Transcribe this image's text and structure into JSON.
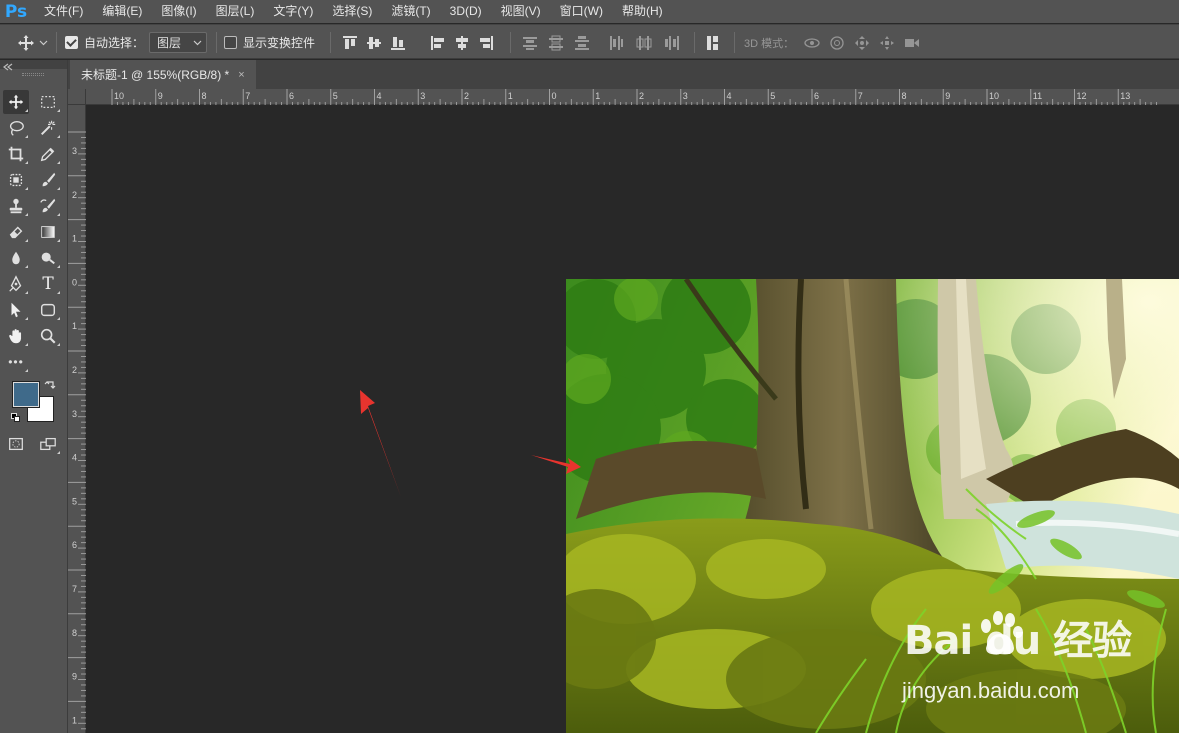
{
  "menubar": {
    "logo": "Ps",
    "items": [
      "文件(F)",
      "编辑(E)",
      "图像(I)",
      "图层(L)",
      "文字(Y)",
      "选择(S)",
      "滤镜(T)",
      "3D(D)",
      "视图(V)",
      "窗口(W)",
      "帮助(H)"
    ]
  },
  "options": {
    "auto_select_label": "自动选择：",
    "auto_select_checked": true,
    "auto_select_target": "图层",
    "show_transform_label": "显示变换控件",
    "show_transform_checked": false,
    "mode_3d_label": "3D 模式："
  },
  "document": {
    "tab_title": "未标题-1 @ 155%(RGB/8) *",
    "close_glyph": "×"
  },
  "rulers": {
    "horizontal_labels": [
      "10",
      "9",
      "8",
      "7",
      "6",
      "5",
      "4",
      "3",
      "2",
      "1",
      "0",
      "1",
      "2",
      "3",
      "4",
      "5",
      "6",
      "7",
      "8",
      "9",
      "10",
      "11",
      "12",
      "13"
    ],
    "vertical_labels": [
      "3",
      "2",
      "1",
      "0",
      "1",
      "2",
      "3",
      "4",
      "5",
      "6",
      "7",
      "8",
      "9",
      "1"
    ]
  },
  "colors": {
    "foreground": "#3f6a8a",
    "background": "#ffffff",
    "annotation_arrow": "#e8342e",
    "ps_blue": "#31a8ff"
  },
  "tools": [
    "move-tool",
    "marquee-tool",
    "lasso-tool",
    "magic-wand-tool",
    "crop-tool",
    "eyedropper-tool",
    "patch-tool",
    "brush-tool",
    "clone-stamp-tool",
    "history-brush-tool",
    "eraser-tool",
    "gradient-tool",
    "blur-tool",
    "dodge-tool",
    "pen-tool",
    "type-tool",
    "path-selection-tool",
    "rectangle-tool",
    "hand-tool",
    "zoom-tool",
    "more-tools"
  ],
  "type_tool_glyph": "T",
  "more_tools_glyph": "•••",
  "watermark": {
    "logo": "Bai du 经验",
    "url": "jingyan.baidu.com"
  }
}
